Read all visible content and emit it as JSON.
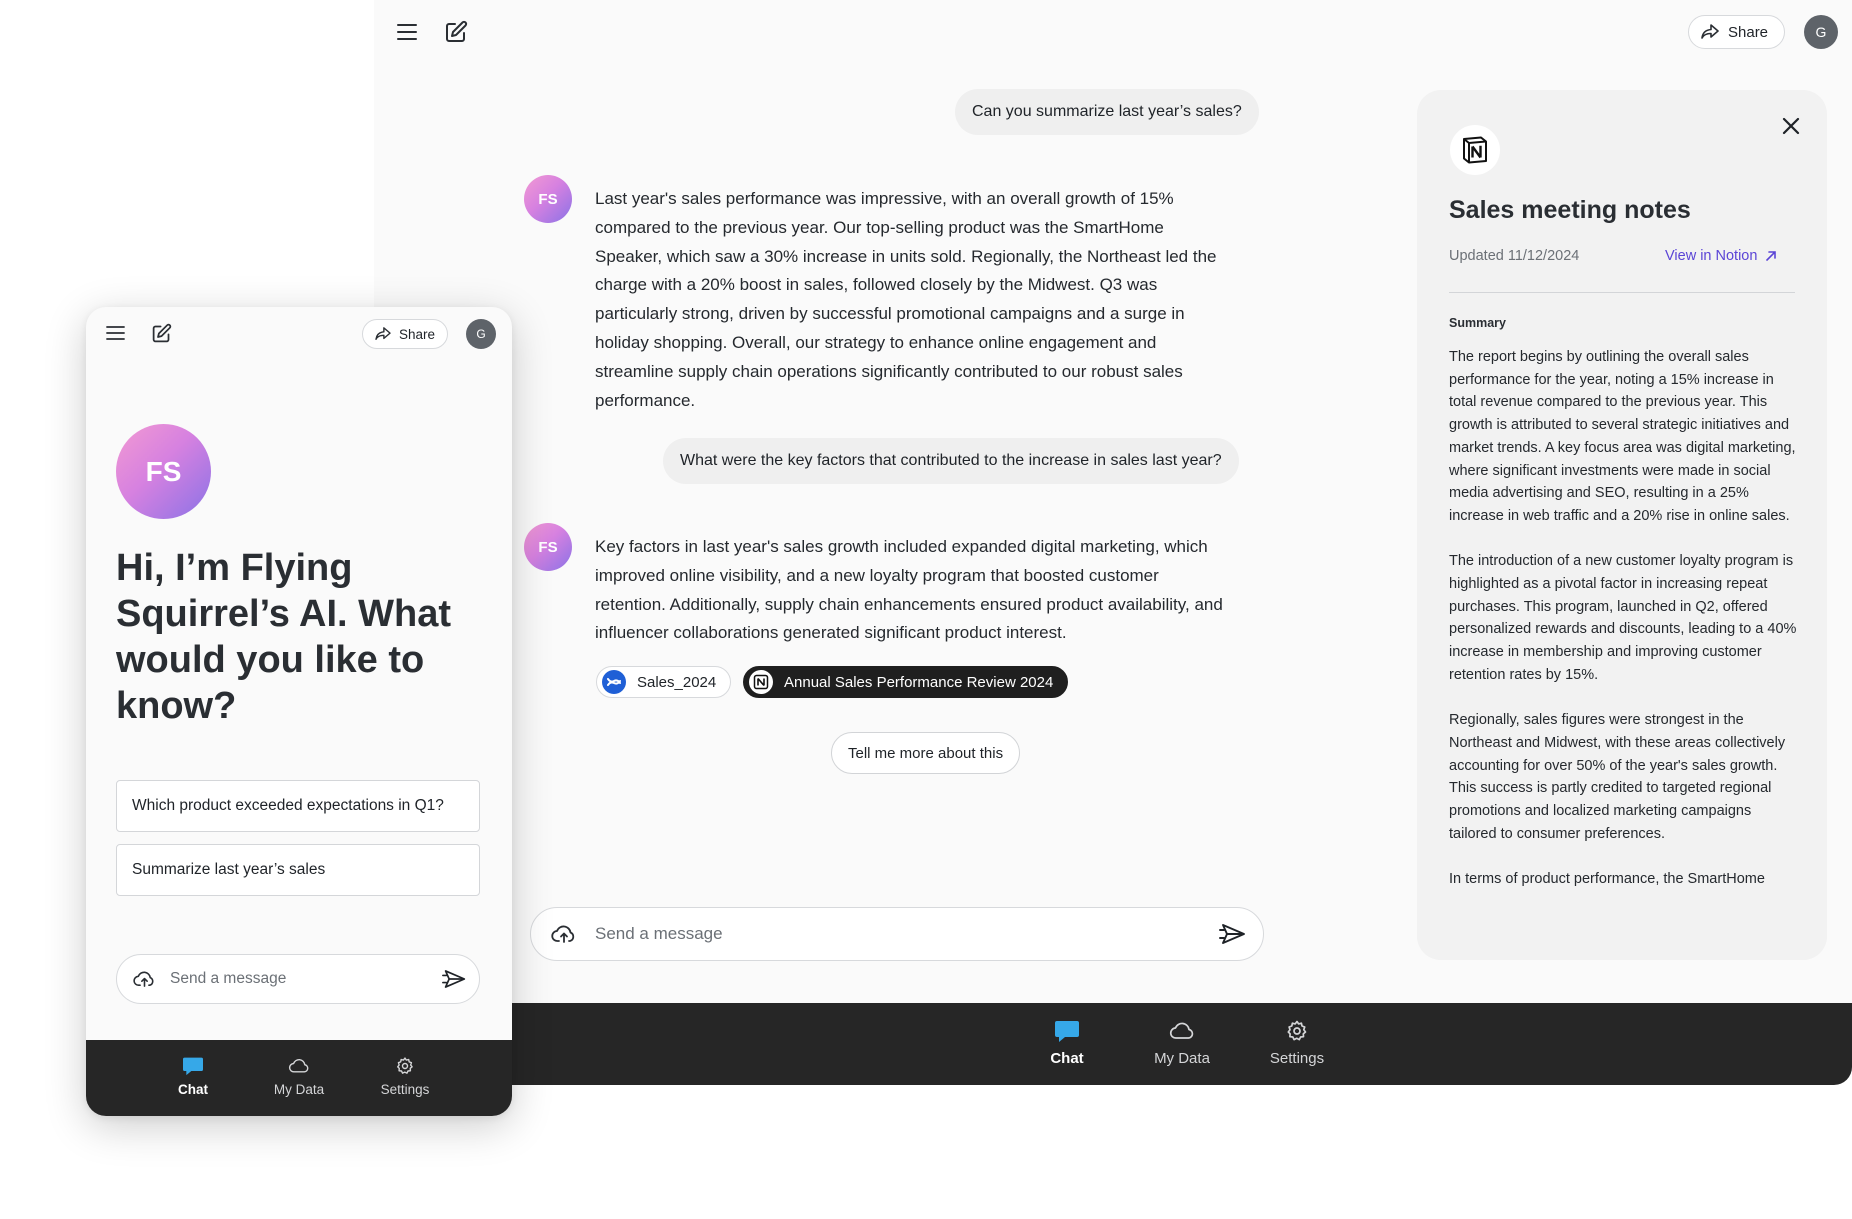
{
  "desktop": {
    "header": {
      "menu_icon": "hamburger-menu-icon",
      "new_chat_icon": "compose-icon",
      "share_label": "Share",
      "avatar_initial": "G"
    },
    "conversation": [
      {
        "role": "user",
        "text": "Can you summarize last year’s sales?"
      },
      {
        "role": "assistant",
        "avatar": "FS",
        "lines": [
          "Last year's sales performance was impressive, with an overall growth of 15%",
          "compared to the previous year. Our top-selling product was the SmartHome",
          "Speaker, which saw a 30% increase in units sold. Regionally, the Northeast led the",
          "charge with a 20% boost in sales, followed closely by the Midwest. Q3 was",
          "particularly strong, driven by successful promotional campaigns and a surge in",
          "holiday shopping. Overall, our strategy to enhance online engagement and",
          "streamline supply chain operations significantly contributed to our robust sales",
          "performance."
        ]
      },
      {
        "role": "user",
        "text": "What were the key factors that contributed to the increase in sales last year?"
      },
      {
        "role": "assistant",
        "avatar": "FS",
        "lines": [
          "Key factors in last year's sales growth included expanded digital marketing, which",
          "improved online visibility, and a new loyalty program that boosted customer",
          "retention. Additionally, supply chain enhancements ensured product availability, and",
          "influencer collaborations generated significant product interest."
        ],
        "sources": [
          {
            "label": "Sales_2024",
            "icon": "confluence-icon"
          },
          {
            "label": "Annual Sales Performance Review 2024",
            "icon": "notion-icon"
          }
        ]
      }
    ],
    "followup_label": "Tell me more about this",
    "composer": {
      "placeholder": "Send a message",
      "attach_icon": "cloud-upload-icon",
      "send_icon": "send-icon"
    },
    "tabs": [
      {
        "label": "Chat",
        "icon": "chat-icon",
        "active": true
      },
      {
        "label": "My Data",
        "icon": "cloud-icon",
        "active": false
      },
      {
        "label": "Settings",
        "icon": "gear-icon",
        "active": false
      }
    ],
    "notes_panel": {
      "logo_icon": "notion-icon",
      "title": "Sales meeting notes",
      "updated": "Updated 11/12/2024",
      "link_label": "View in Notion",
      "summary_heading": "Summary",
      "paragraphs": [
        "The report begins by outlining the overall sales performance for the year, noting a 15% increase in total revenue compared to the previous year. This growth is attributed to several strategic initiatives and market trends. A key focus area was digital marketing, where significant investments were made in social media advertising and SEO, resulting in a 25% increase in web traffic and a 20% rise in online sales.",
        "The introduction of a new customer loyalty program is highlighted as a pivotal factor in increasing repeat purchases. This program, launched in Q2, offered personalized rewards and discounts, leading to a 40% increase in membership and improving customer retention rates by 15%.",
        "Regionally, sales figures were strongest in the Northeast and Midwest, with these areas collectively accounting for over 50% of the year's sales growth. This success is partly credited to targeted regional promotions and localized marketing campaigns tailored to consumer preferences.",
        "In terms of product performance, the SmartHome"
      ]
    }
  },
  "mobile": {
    "header": {
      "share_label": "Share",
      "avatar_initial": "G"
    },
    "ai_avatar": "FS",
    "greeting": "Hi, I’m Flying Squirrel’s AI. What would you like to know?",
    "suggestions": [
      "Which product exceeded expectations in Q1?",
      "Summarize last year’s sales"
    ],
    "composer": {
      "placeholder": "Send a message"
    },
    "tabs": [
      {
        "label": "Chat",
        "active": true
      },
      {
        "label": "My Data",
        "active": false
      },
      {
        "label": "Settings",
        "active": false
      }
    ]
  },
  "colors": {
    "accent_link": "#5b45d6",
    "tabbar_bg": "#262626",
    "chat_tab_icon": "#36a8e8",
    "confluence_blue": "#1f5fd6"
  }
}
